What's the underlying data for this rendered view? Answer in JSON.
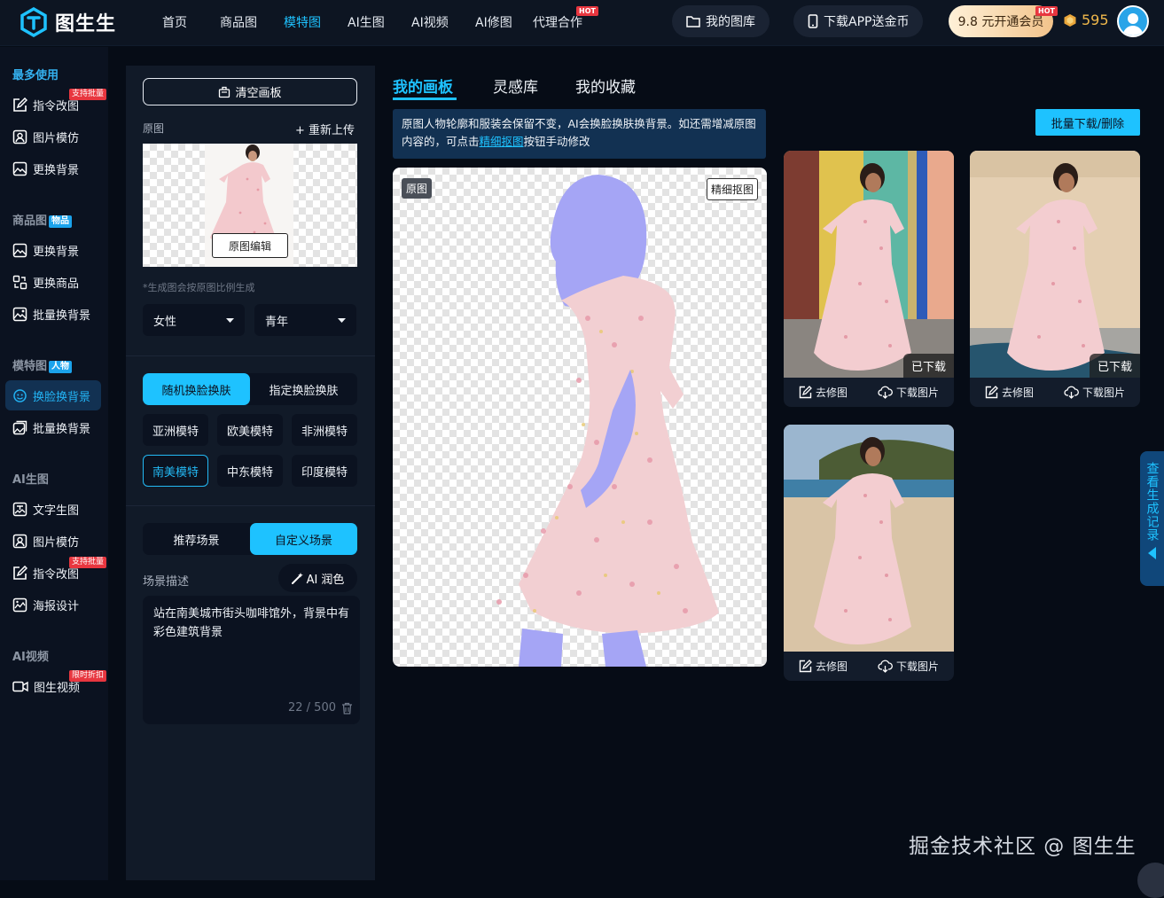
{
  "brand": {
    "name": "图生生"
  },
  "nav": {
    "items": [
      "首页",
      "商品图",
      "模特图",
      "AI生图",
      "AI视频",
      "AI修图",
      "代理合作"
    ],
    "active_index": 2,
    "hot_label": "HOT",
    "gallery_label": "我的图库",
    "app_label": "下载APP送金币",
    "vip_label": "9.8 元开通会员",
    "coins": "595"
  },
  "sidebar": {
    "groups": [
      {
        "title": "最多使用",
        "badge": "",
        "items": [
          {
            "label": "指令改图",
            "tag": "支持批量"
          },
          {
            "label": "图片模仿",
            "tag": ""
          },
          {
            "label": "更换背景",
            "tag": ""
          }
        ]
      },
      {
        "title": "商品图",
        "badge": "物品",
        "items": [
          {
            "label": "更换背景",
            "tag": ""
          },
          {
            "label": "更换商品",
            "tag": ""
          },
          {
            "label": "批量换背景",
            "tag": ""
          }
        ]
      },
      {
        "title": "模特图",
        "badge": "人物",
        "items": [
          {
            "label": "换脸换背景",
            "tag": ""
          },
          {
            "label": "批量换背景",
            "tag": ""
          }
        ]
      },
      {
        "title": "AI生图",
        "badge": "",
        "items": [
          {
            "label": "文字生图",
            "tag": ""
          },
          {
            "label": "图片模仿",
            "tag": ""
          },
          {
            "label": "指令改图",
            "tag": "支持批量"
          },
          {
            "label": "海报设计",
            "tag": ""
          }
        ]
      },
      {
        "title": "AI视频",
        "badge": "",
        "items": [
          {
            "label": "图生视频",
            "tag": "限时折扣"
          }
        ]
      }
    ]
  },
  "panel": {
    "clear_label": "清空画板",
    "orig_label": "原图",
    "reupload_label": "+ 重新上传",
    "edit_label": "原图编辑",
    "ratio_note": "*生成图会按原图比例生成",
    "gender": "女性",
    "age": "青年",
    "mode_options": [
      "随机换脸换肤",
      "指定换脸换肤"
    ],
    "models": [
      "亚洲模特",
      "欧美模特",
      "非洲模特",
      "南美模特",
      "中东模特",
      "印度模特"
    ],
    "scene_options": [
      "推荐场景",
      "自定义场景"
    ],
    "scene_label": "场景描述",
    "ai_label": "AI 润色",
    "description": "站在南美城市街头咖啡馆外，背景中有彩色建筑背景",
    "counter": "22 / 500"
  },
  "main": {
    "tabs": [
      "我的画板",
      "灵感库",
      "我的收藏"
    ],
    "info_part1": "原图人物轮廓和服装会保留不变，AI会换脸换肤换背景。如还需增减原图内容的，可点击",
    "info_link": "精细抠图",
    "info_part2": "按钮手动修改",
    "batch_label": "批量下载/删除",
    "canvas_tag": "原图",
    "refine_label": "精细抠图",
    "downloaded_label": "已下载",
    "edit_action": "去修图",
    "download_action": "下载图片",
    "history_label": "查看生成记录"
  },
  "watermark": "掘金技术社区 @ 图生生",
  "colors": {
    "accent": "#1ec2ff",
    "hot": "#e8363f",
    "mask": "#a5a5f5"
  }
}
